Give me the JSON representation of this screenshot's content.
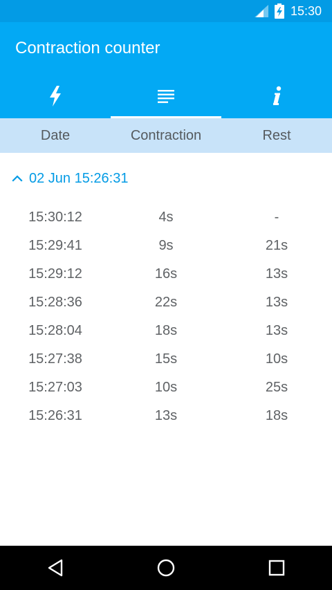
{
  "status_bar": {
    "time": "15:30"
  },
  "app": {
    "title": "Contraction counter",
    "accent_color": "#03A9F4",
    "status_color": "#039BE5"
  },
  "tabs": [
    {
      "icon": "lightning-icon",
      "active": false
    },
    {
      "icon": "list-icon",
      "active": true
    },
    {
      "icon": "info-icon",
      "active": false
    }
  ],
  "columns": [
    "Date",
    "Contraction",
    "Rest"
  ],
  "session": {
    "title": "02 Jun 15:26:31",
    "expanded": true
  },
  "rows": [
    {
      "date": "15:30:12",
      "contraction": "4s",
      "rest": "-"
    },
    {
      "date": "15:29:41",
      "contraction": "9s",
      "rest": "21s"
    },
    {
      "date": "15:29:12",
      "contraction": "16s",
      "rest": "13s"
    },
    {
      "date": "15:28:36",
      "contraction": "22s",
      "rest": "13s"
    },
    {
      "date": "15:28:04",
      "contraction": "18s",
      "rest": "13s"
    },
    {
      "date": "15:27:38",
      "contraction": "15s",
      "rest": "10s"
    },
    {
      "date": "15:27:03",
      "contraction": "10s",
      "rest": "25s"
    },
    {
      "date": "15:26:31",
      "contraction": "13s",
      "rest": "18s"
    }
  ]
}
